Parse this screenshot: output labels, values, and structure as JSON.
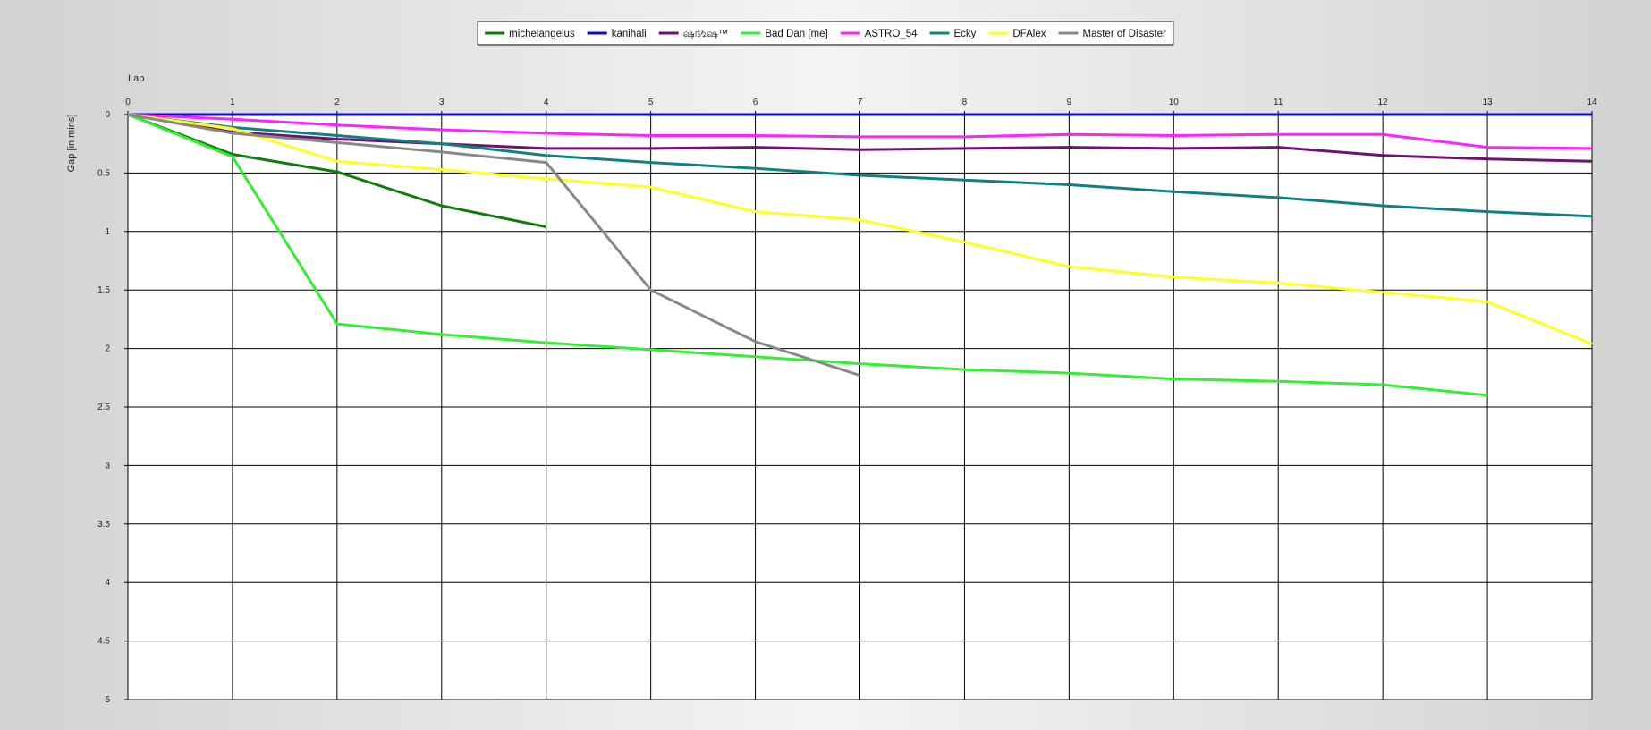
{
  "chart_data": {
    "type": "line",
    "xlabel": "Lap",
    "ylabel": "Gap [in mins]",
    "x_ticks": [
      "0",
      "1",
      "2",
      "3",
      "4",
      "5",
      "6",
      "7",
      "8",
      "9",
      "10",
      "11",
      "12",
      "13",
      "14"
    ],
    "y_ticks": [
      "0",
      "0.5",
      "1",
      "1.5",
      "2",
      "2.5",
      "3",
      "3.5",
      "4",
      "4.5",
      "5"
    ],
    "xlim": [
      0,
      14
    ],
    "ylim": [
      0,
      5
    ],
    "y_inverted": true,
    "grid": true,
    "legend_position": "top-center",
    "series": [
      {
        "name": "michelangelus",
        "color": "#117a11",
        "x": [
          0,
          1,
          2,
          3,
          4
        ],
        "y": [
          0,
          0.34,
          0.49,
          0.78,
          0.96
        ]
      },
      {
        "name": "kanihali",
        "color": "#0a0ad0",
        "x": [
          0,
          1,
          2,
          3,
          4,
          5,
          6,
          7,
          8,
          9,
          10,
          11,
          12,
          13,
          14
        ],
        "y": [
          0,
          0,
          0,
          0,
          0,
          0,
          0,
          0,
          0,
          0,
          0,
          0,
          0,
          0,
          0
        ]
      },
      {
        "name": "ஷ௺ஷ™",
        "color": "#6e1470",
        "x": [
          0,
          1,
          2,
          3,
          4,
          5,
          6,
          7,
          8,
          9,
          10,
          11,
          12,
          13,
          14
        ],
        "y": [
          0,
          0.15,
          0.21,
          0.25,
          0.29,
          0.29,
          0.28,
          0.3,
          0.29,
          0.28,
          0.29,
          0.28,
          0.35,
          0.38,
          0.4
        ]
      },
      {
        "name": "Bad Dan [me]",
        "color": "#33ee33",
        "x": [
          0,
          1,
          2,
          3,
          4,
          5,
          6,
          7,
          8,
          9,
          10,
          11,
          12,
          13
        ],
        "y": [
          0,
          0.36,
          1.79,
          1.88,
          1.95,
          2.01,
          2.07,
          2.13,
          2.18,
          2.21,
          2.26,
          2.28,
          2.31,
          2.4
        ]
      },
      {
        "name": "ASTRO_54",
        "color": "#ff22ff",
        "x": [
          0,
          1,
          2,
          3,
          4,
          5,
          6,
          7,
          8,
          9,
          10,
          11,
          12,
          13,
          14
        ],
        "y": [
          0,
          0.04,
          0.09,
          0.13,
          0.16,
          0.18,
          0.18,
          0.19,
          0.19,
          0.17,
          0.18,
          0.17,
          0.17,
          0.28,
          0.29
        ]
      },
      {
        "name": "Ecky",
        "color": "#128080",
        "x": [
          0,
          1,
          2,
          3,
          4,
          5,
          6,
          7,
          8,
          9,
          10,
          11,
          12,
          13,
          14
        ],
        "y": [
          0,
          0.11,
          0.18,
          0.25,
          0.35,
          0.41,
          0.46,
          0.52,
          0.56,
          0.6,
          0.66,
          0.71,
          0.78,
          0.83,
          0.87
        ]
      },
      {
        "name": "DFAlex",
        "color": "#ffff22",
        "x": [
          0,
          1,
          2,
          3,
          4,
          5,
          6,
          7,
          8,
          9,
          10,
          11,
          12,
          13,
          14
        ],
        "y": [
          0,
          0.12,
          0.4,
          0.47,
          0.55,
          0.62,
          0.83,
          0.9,
          1.09,
          1.3,
          1.39,
          1.44,
          1.52,
          1.6,
          1.96
        ]
      },
      {
        "name": "Master of Disaster",
        "color": "#888888",
        "x": [
          0,
          1,
          2,
          3,
          4,
          5,
          6,
          7
        ],
        "y": [
          0,
          0.16,
          0.24,
          0.32,
          0.41,
          1.5,
          1.94,
          2.23
        ]
      }
    ]
  }
}
